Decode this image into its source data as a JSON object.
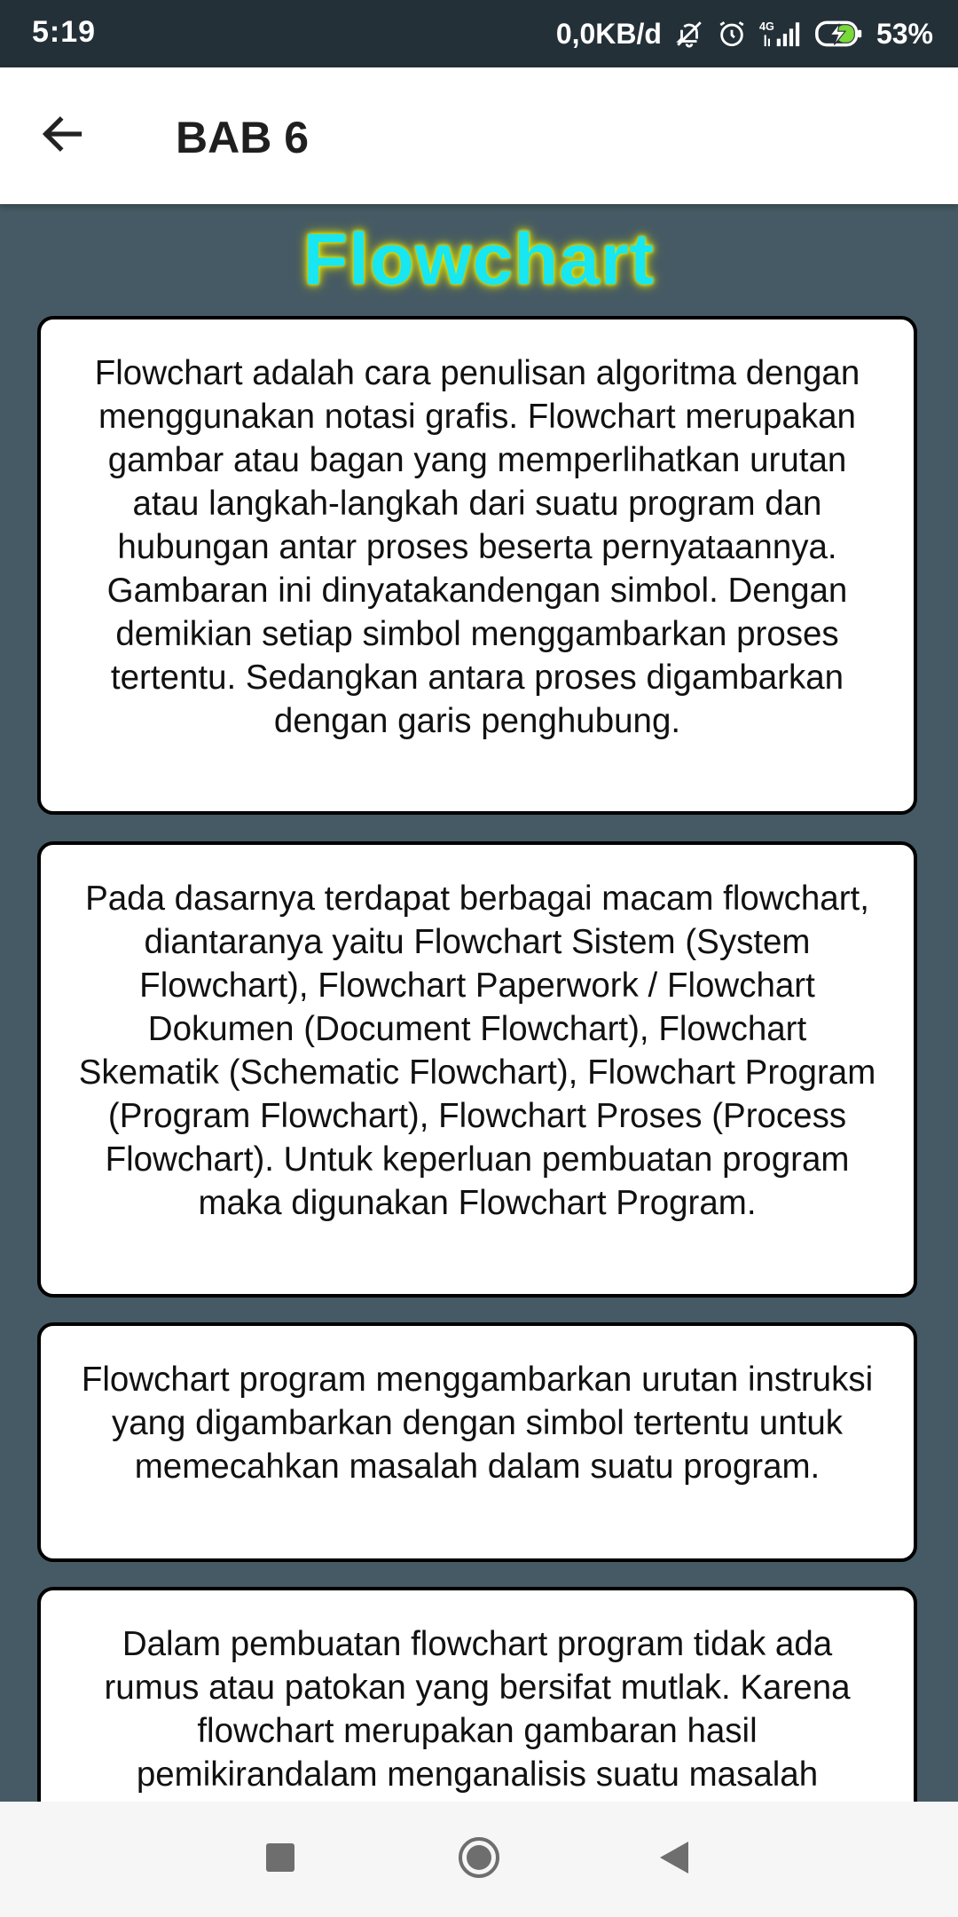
{
  "status_bar": {
    "time": "5:19",
    "network_speed": "0,0KB/d",
    "network_type": "4G",
    "battery": "53%",
    "icons": [
      "bell-off-icon",
      "alarm-icon",
      "signal-icon",
      "battery-charging-icon"
    ]
  },
  "toolbar": {
    "back_icon": "arrow-left-icon",
    "title": "BAB 6"
  },
  "content": {
    "heading": "Flowchart",
    "heading_color": "#18e6f0",
    "paragraphs": [
      "Flowchart adalah cara penulisan algoritma dengan menggunakan notasi grafis. Flowchart merupakan gambar atau bagan yang memperlihatkan urutan atau langkah-langkah dari suatu program dan hubungan antar proses beserta pernyataannya. Gambaran ini dinyatakandengan simbol. Dengan demikian setiap simbol menggambarkan proses tertentu. Sedangkan antara proses digambarkan dengan garis penghubung.",
      "Pada dasarnya terdapat berbagai macam flowchart, diantaranya yaitu Flowchart Sistem (System Flowchart), Flowchart Paperwork / Flowchart Dokumen (Document Flowchart), Flowchart Skematik (Schematic Flowchart), Flowchart Program (Program Flowchart), Flowchart Proses (Process Flowchart). Untuk keperluan pembuatan program maka digunakan Flowchart Program.",
      "Flowchart program menggambarkan urutan instruksi yang digambarkan dengan simbol tertentu untuk memecahkan masalah dalam suatu program.",
      "Dalam pembuatan flowchart program tidak ada rumus atau patokan yang bersifat mutlak. Karena flowchart merupakan gambaran hasil pemikirandalam menganalisis suatu masalah"
    ]
  },
  "nav_bar": {
    "recents_icon": "square-recents-icon",
    "home_icon": "circle-home-icon",
    "back_icon": "triangle-back-icon"
  },
  "colors": {
    "background": "#455a64",
    "status_bar": "#243038",
    "card": "#ffffff"
  }
}
